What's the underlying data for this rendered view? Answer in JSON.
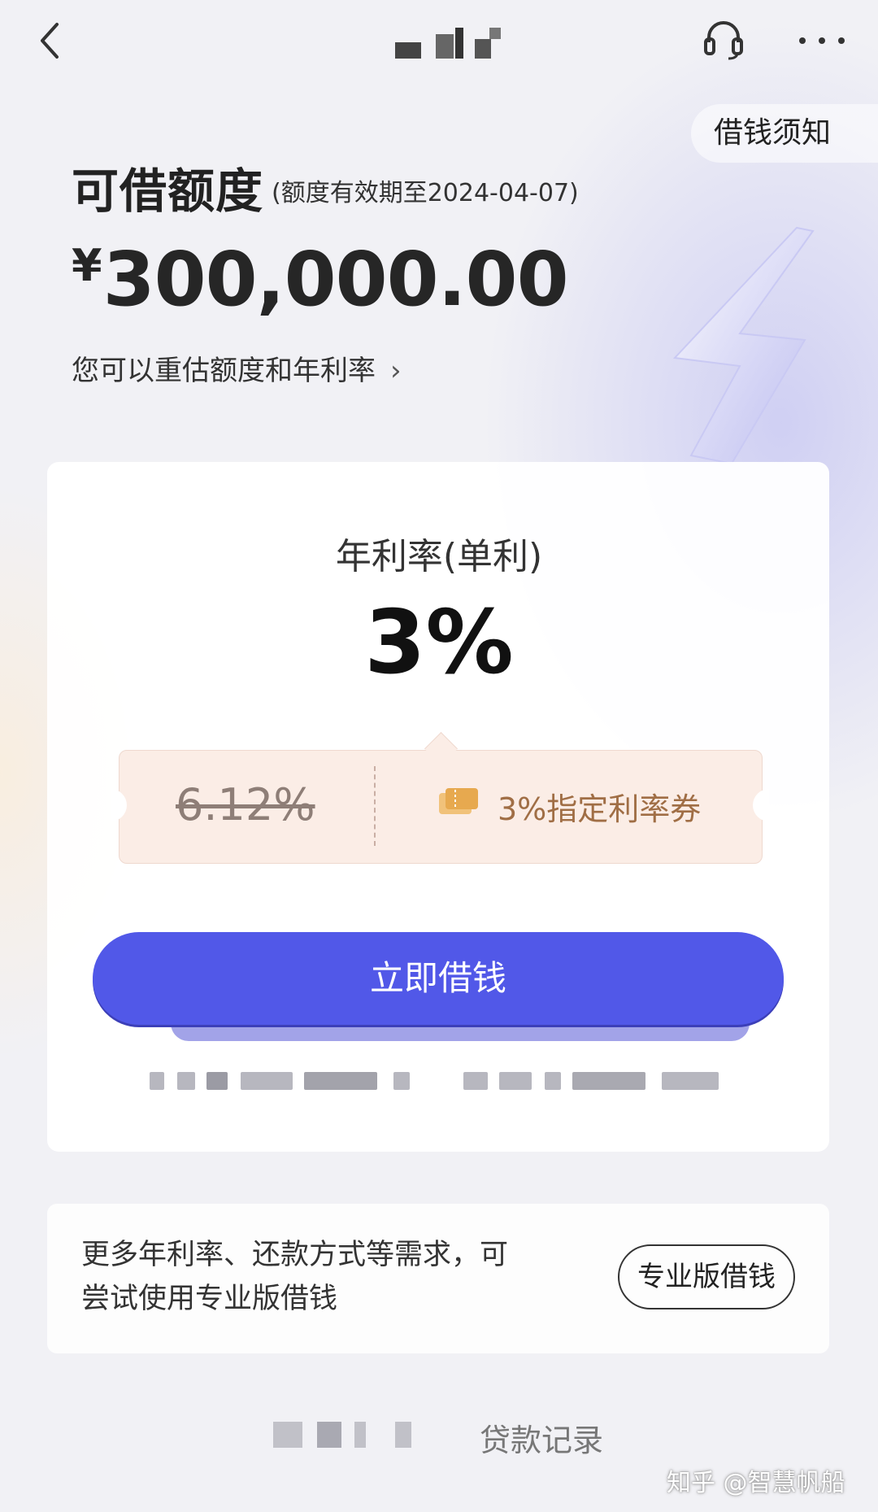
{
  "nav": {
    "back_icon": "chevron-left-icon",
    "headset_icon": "headset-icon",
    "more_icon": "more-dots-icon",
    "more_label": "···"
  },
  "notice": {
    "label": "借钱须知"
  },
  "credit": {
    "title": "可借额度",
    "validity": "(额度有效期至2024-04-07)",
    "currency_symbol": "¥",
    "amount": "300,000.00",
    "reassess_text": "您可以重估额度和年利率",
    "reassess_chevron": "›"
  },
  "rate": {
    "label": "年利率(单利)",
    "value": "3%"
  },
  "coupon": {
    "original_rate": "6.12%",
    "icon": "ticket-icon",
    "text": "3%指定利率券"
  },
  "actions": {
    "borrow_button": "立即借钱"
  },
  "pro": {
    "text_line1": "更多年利率、还款方式等需求，可",
    "text_line2": "尝试使用专业版借钱",
    "button": "专业版借钱"
  },
  "footer": {
    "loan_records": "贷款记录",
    "watermark": "知乎 @智慧帆船"
  },
  "colors": {
    "primary_button": "#5158e8",
    "coupon_bg": "#fbede6",
    "coupon_text": "#a06e45",
    "page_bg": "#f1f1f5"
  }
}
